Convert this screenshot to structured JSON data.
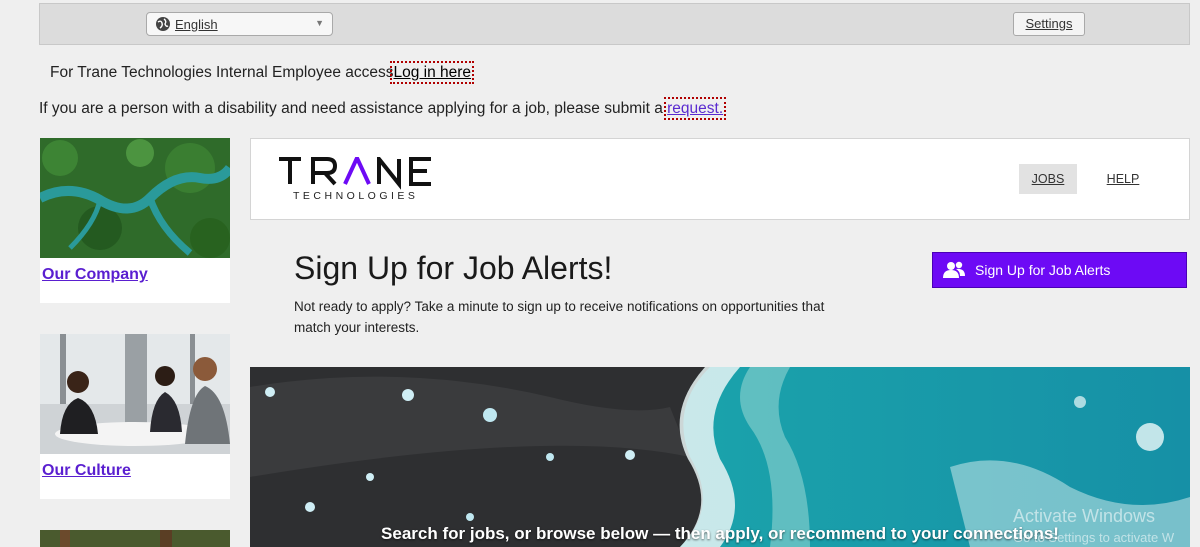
{
  "topbar": {
    "language": "English",
    "settings_label": "Settings"
  },
  "notices": {
    "employee_text": "For Trane Technologies Internal Employee access",
    "employee_link": "Log in here",
    "disability_text": "If you are a person with a disability and need assistance applying for a job, please submit a",
    "disability_link": "request."
  },
  "sidebar": {
    "cards": [
      {
        "label": "Our Company"
      },
      {
        "label": "Our Culture"
      }
    ]
  },
  "header": {
    "logo_main": "TRANE",
    "logo_sub": "TECHNOLOGIES",
    "nav": [
      {
        "label": "JOBS"
      },
      {
        "label": "HELP"
      }
    ]
  },
  "alerts": {
    "title": "Sign Up for Job Alerts!",
    "description": "Not ready to apply? Take a minute to sign up to receive notifications on opportunities that match your interests.",
    "button_label": "Sign Up for Job Alerts"
  },
  "hero": {
    "caption": "Search for jobs, or browse below — then apply, or recommend to your connections!"
  },
  "watermark": {
    "line1": "Activate Windows",
    "line2": "Go to Settings to activate W"
  },
  "colors": {
    "accent": "#6d0af5",
    "link": "#5a1fd0",
    "background": "#efefef"
  },
  "icons": [
    "globe-icon",
    "chevron-down-icon",
    "users-icon"
  ]
}
